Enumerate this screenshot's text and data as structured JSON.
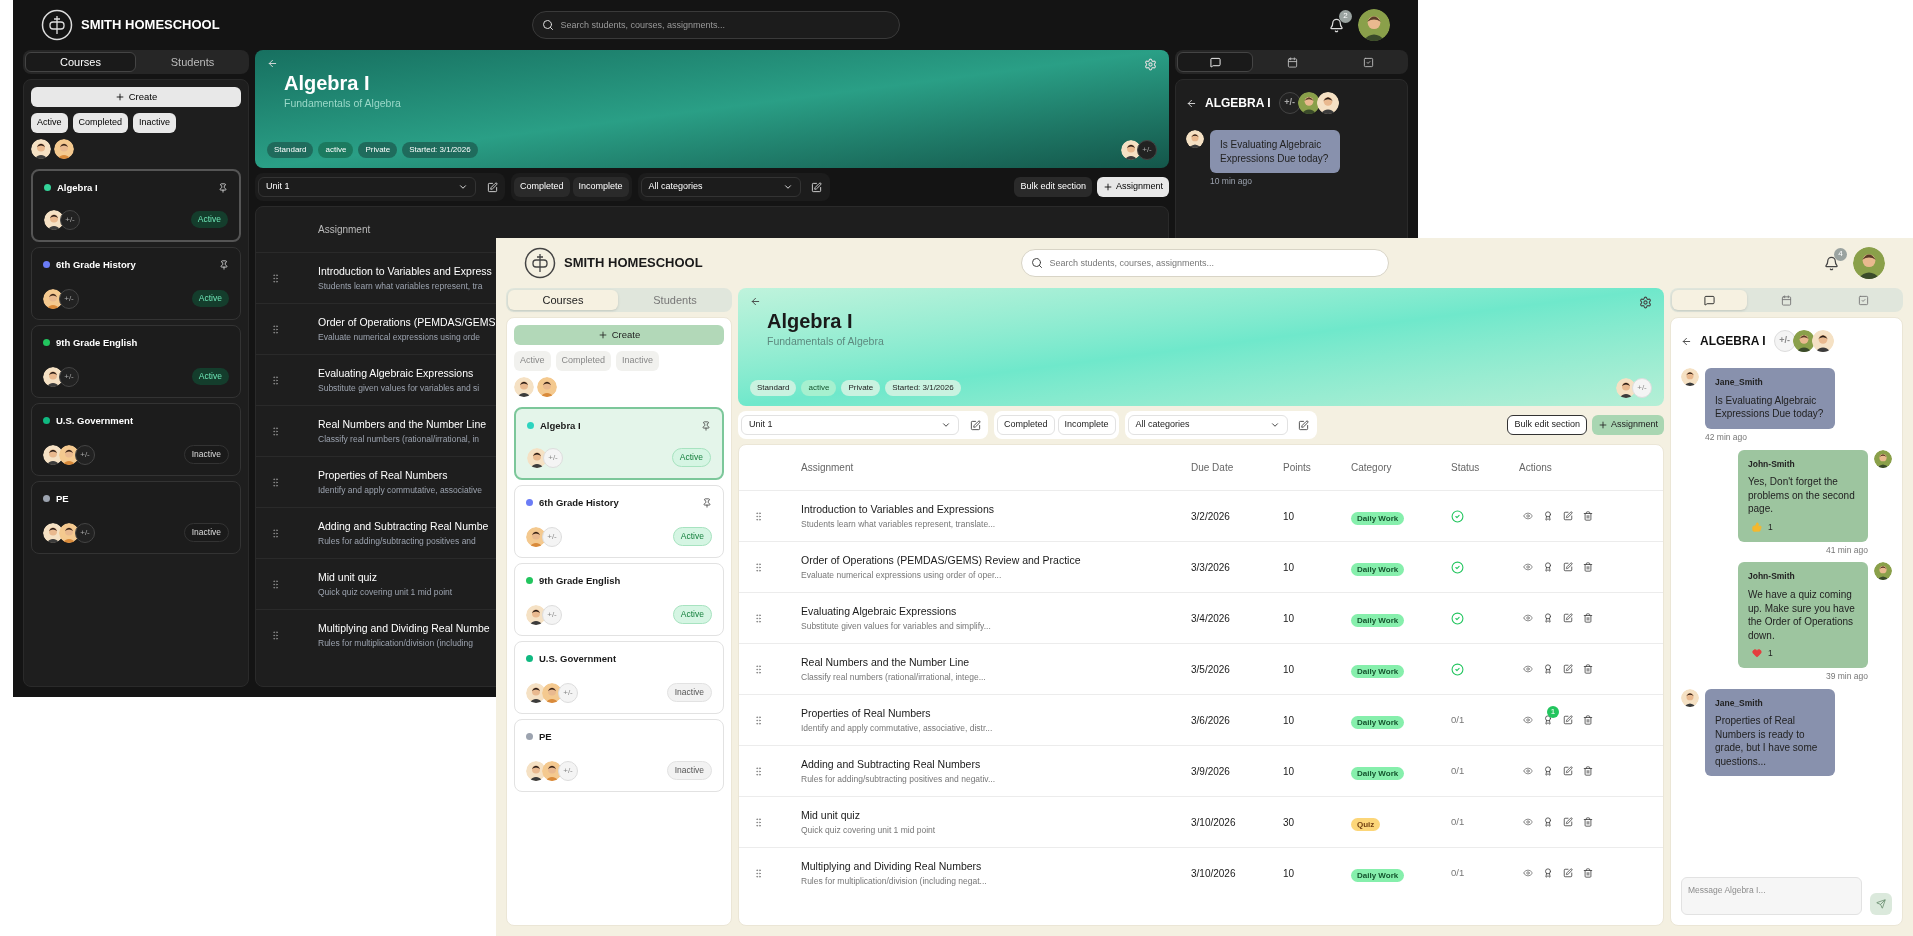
{
  "windows": [
    {
      "kind": "dark",
      "brand": "SMITH HOMESCHOOL",
      "search": {
        "placeholder": "Search students, courses, assignments..."
      },
      "notifications": "2",
      "sidebar": {
        "tabs": [
          {
            "label": "Courses",
            "selected": true
          },
          {
            "label": "Students",
            "selected": false
          }
        ],
        "create": "Create",
        "filters": [
          "Active",
          "Completed",
          "Inactive"
        ],
        "people": [
          {
            "kind": "girl"
          },
          {
            "kind": "boy"
          }
        ],
        "courses": [
          {
            "name": "Algebra I",
            "color": "#34d399",
            "pinned": true,
            "selected": true,
            "members": [
              {
                "kind": "girl"
              }
            ],
            "members_button": "+/-",
            "status": "Active",
            "active": true
          },
          {
            "name": "6th Grade History",
            "color": "#6b7cf6",
            "pinned": true,
            "selected": false,
            "members": [
              {
                "kind": "boy"
              }
            ],
            "members_button": "+/-",
            "status": "Active",
            "active": true
          },
          {
            "name": "9th Grade English",
            "color": "#22c55e",
            "pinned": false,
            "selected": false,
            "members": [
              {
                "kind": "girl"
              }
            ],
            "members_button": "+/-",
            "status": "Active",
            "active": true
          },
          {
            "name": "U.S. Government",
            "color": "#10b981",
            "pinned": false,
            "selected": false,
            "members": [
              {
                "kind": "girl"
              },
              {
                "kind": "boy"
              }
            ],
            "members_button": "+/-",
            "status": "Inactive",
            "active": false
          },
          {
            "name": "PE",
            "color": "#9ca3af",
            "pinned": false,
            "selected": false,
            "members": [
              {
                "kind": "girl"
              },
              {
                "kind": "boy"
              }
            ],
            "members_button": "+/-",
            "status": "Inactive",
            "active": false
          }
        ]
      },
      "banner": {
        "title": "Algebra I",
        "subtitle": "Fundamentals of Algebra",
        "tags": [
          {
            "label": "Standard",
            "highlight": false
          },
          {
            "label": "active",
            "highlight": true
          },
          {
            "label": "Private",
            "highlight": false
          },
          {
            "label": "Started: 3/1/2026",
            "highlight": false
          }
        ],
        "members": [
          {
            "kind": "girl"
          }
        ],
        "members_button": "+/-"
      },
      "toolbar": {
        "unit": "Unit 1",
        "filters": [
          "Completed",
          "Incomplete"
        ],
        "category": "All categories",
        "bulk": "Bulk edit section",
        "add": "Assignment"
      },
      "table": {
        "columns": [
          "Assignment"
        ],
        "rows": [
          {
            "title": "Introduction to Variables and Express",
            "description": "Students learn what variables represent, tra"
          },
          {
            "title": "Order of Operations (PEMDAS/GEMS",
            "description": "Evaluate numerical expressions using orde"
          },
          {
            "title": "Evaluating Algebraic Expressions",
            "description": "Substitute given values for variables and si"
          },
          {
            "title": "Real Numbers and the Number Line",
            "description": "Classify real numbers (rational/irrational, in"
          },
          {
            "title": "Properties of Real Numbers",
            "description": "Identify and apply commutative, associative"
          },
          {
            "title": "Adding and Subtracting Real Numbe",
            "description": "Rules for adding/subtracting positives and"
          },
          {
            "title": "Mid unit quiz",
            "description": "Quick quiz covering unit 1 mid point"
          },
          {
            "title": "Multiplying and Dividing Real Numbe",
            "description": "Rules for multiplication/division (including"
          }
        ]
      },
      "chat": {
        "tabs": [
          {
            "kind": "messages",
            "selected": true
          },
          {
            "kind": "calendar",
            "selected": false
          },
          {
            "kind": "tasks",
            "selected": false
          }
        ],
        "title": "ALGEBRA I",
        "members_button": "+/-",
        "members": [
          {
            "kind": "man"
          },
          {
            "kind": "girl"
          }
        ],
        "messages": [
          {
            "mine": false,
            "avatar": {
              "kind": "girl"
            },
            "text": "Is Evaluating Algebraic Expressions Due today?",
            "time": "10 min ago"
          }
        ]
      }
    },
    {
      "kind": "light",
      "brand": "SMITH HOMESCHOOL",
      "search": {
        "placeholder": "Search students, courses, assignments..."
      },
      "notifications": "4",
      "sidebar": {
        "tabs": [
          {
            "label": "Courses",
            "selected": true
          },
          {
            "label": "Students",
            "selected": false
          }
        ],
        "create": "Create",
        "filters": [
          "Active",
          "Completed",
          "Inactive"
        ],
        "people": [
          {
            "kind": "girl"
          },
          {
            "kind": "boy"
          }
        ],
        "courses": [
          {
            "name": "Algebra I",
            "color": "#2dd4bf",
            "pinned": true,
            "selected": true,
            "members": [
              {
                "kind": "girl"
              }
            ],
            "members_button": "+/-",
            "status": "Active",
            "active": true
          },
          {
            "name": "6th Grade History",
            "color": "#6b7cf6",
            "pinned": true,
            "selected": false,
            "members": [
              {
                "kind": "boy"
              }
            ],
            "members_button": "+/-",
            "status": "Active",
            "active": true
          },
          {
            "name": "9th Grade English",
            "color": "#22c55e",
            "pinned": false,
            "selected": false,
            "members": [
              {
                "kind": "girl"
              }
            ],
            "members_button": "+/-",
            "status": "Active",
            "active": true
          },
          {
            "name": "U.S. Government",
            "color": "#10b981",
            "pinned": false,
            "selected": false,
            "members": [
              {
                "kind": "girl"
              },
              {
                "kind": "boy"
              }
            ],
            "members_button": "+/-",
            "status": "Inactive",
            "active": false
          },
          {
            "name": "PE",
            "color": "#9ca3af",
            "pinned": false,
            "selected": false,
            "members": [
              {
                "kind": "girl"
              },
              {
                "kind": "boy"
              }
            ],
            "members_button": "+/-",
            "status": "Inactive",
            "active": false
          }
        ]
      },
      "banner": {
        "title": "Algebra I",
        "subtitle": "Fundamentals of Algebra",
        "tags": [
          {
            "label": "Standard",
            "highlight": false
          },
          {
            "label": "active",
            "highlight": true
          },
          {
            "label": "Private",
            "highlight": false
          },
          {
            "label": "Started: 3/1/2026",
            "highlight": false
          }
        ],
        "members": [
          {
            "kind": "girl"
          }
        ],
        "members_button": "+/-"
      },
      "toolbar": {
        "unit": "Unit 1",
        "filters": [
          "Completed",
          "Incomplete"
        ],
        "category": "All categories",
        "bulk": "Bulk edit section",
        "add": "Assignment"
      },
      "table": {
        "columns": [
          "Assignment",
          "Due Date",
          "Points",
          "Category",
          "Status",
          "Actions"
        ],
        "rows": [
          {
            "title": "Introduction to Variables and Expressions",
            "description": "Students learn what variables represent, translate...",
            "due": "3/2/2026",
            "points": "10",
            "category": {
              "label": "Daily Work",
              "kind": "daily"
            },
            "completed": true
          },
          {
            "title": "Order of Operations (PEMDAS/GEMS) Review and Practice",
            "description": "Evaluate numerical expressions using order of oper...",
            "due": "3/3/2026",
            "points": "10",
            "category": {
              "label": "Daily Work",
              "kind": "daily"
            },
            "completed": true
          },
          {
            "title": "Evaluating Algebraic Expressions",
            "description": "Substitute given values for variables and simplify...",
            "due": "3/4/2026",
            "points": "10",
            "category": {
              "label": "Daily Work",
              "kind": "daily"
            },
            "completed": true
          },
          {
            "title": "Real Numbers and the Number Line",
            "description": "Classify real numbers (rational/irrational, intege...",
            "due": "3/5/2026",
            "points": "10",
            "category": {
              "label": "Daily Work",
              "kind": "daily"
            },
            "completed": true
          },
          {
            "title": "Properties of Real Numbers",
            "description": "Identify and apply commutative, associative, distr...",
            "due": "3/6/2026",
            "points": "10",
            "category": {
              "label": "Daily Work",
              "kind": "daily"
            },
            "completed": false,
            "status": "0/1",
            "review_count": "1"
          },
          {
            "title": "Adding and Subtracting Real Numbers",
            "description": "Rules for adding/subtracting positives and negativ...",
            "due": "3/9/2026",
            "points": "10",
            "category": {
              "label": "Daily Work",
              "kind": "daily"
            },
            "completed": false,
            "status": "0/1"
          },
          {
            "title": "Mid unit quiz",
            "description": "Quick quiz covering unit 1 mid point",
            "due": "3/10/2026",
            "points": "30",
            "category": {
              "label": "Quiz",
              "kind": "quiz"
            },
            "completed": false,
            "status": "0/1"
          },
          {
            "title": "Multiplying and Dividing Real Numbers",
            "description": "Rules for multiplication/division (including negat...",
            "due": "3/10/2026",
            "points": "10",
            "category": {
              "label": "Daily Work",
              "kind": "daily"
            },
            "completed": false,
            "status": "0/1"
          }
        ]
      },
      "chat": {
        "tabs": [
          {
            "kind": "messages",
            "selected": true
          },
          {
            "kind": "calendar",
            "selected": false
          },
          {
            "kind": "tasks",
            "selected": false
          }
        ],
        "title": "ALGEBRA I",
        "members_button": "+/-",
        "members": [
          {
            "kind": "man"
          },
          {
            "kind": "girl"
          }
        ],
        "messages": [
          {
            "mine": false,
            "avatar": {
              "kind": "girl"
            },
            "author": "Jane_Smith",
            "text": "Is Evaluating Algebraic Expressions Due today?",
            "time": "42 min ago"
          },
          {
            "mine": true,
            "avatar": {
              "kind": "man"
            },
            "author": "John-Smith",
            "text": "Yes, Don't forget the problems on the second page.",
            "reaction": {
              "kind": "thumbs-up",
              "count": "1"
            },
            "time": "41 min ago"
          },
          {
            "mine": true,
            "avatar": {
              "kind": "man"
            },
            "author": "John-Smith",
            "text": "We have a quiz coming up. Make sure you have the Order of Operations down.",
            "reaction": {
              "kind": "heart",
              "count": "1"
            },
            "time": "39 min ago"
          },
          {
            "mine": false,
            "avatar": {
              "kind": "girl"
            },
            "author": "Jane_Smith",
            "text": "Properties of Real Numbers is ready to grade, but I have some questions..."
          }
        ],
        "composer": {
          "placeholder": "Message Algebra I..."
        }
      }
    }
  ]
}
